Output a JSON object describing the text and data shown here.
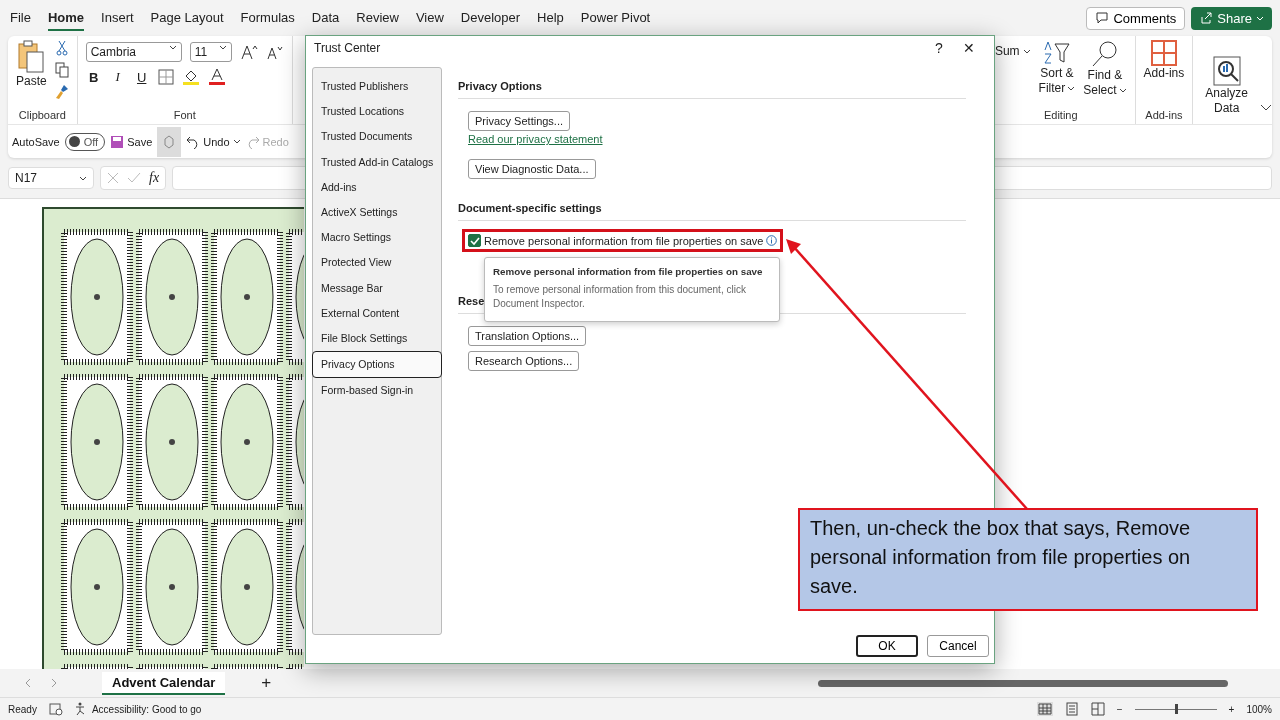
{
  "ribbon_tabs": [
    {
      "label": "File",
      "selected": false
    },
    {
      "label": "Home",
      "selected": true
    },
    {
      "label": "Insert",
      "selected": false
    },
    {
      "label": "Page Layout",
      "selected": false
    },
    {
      "label": "Formulas",
      "selected": false
    },
    {
      "label": "Data",
      "selected": false
    },
    {
      "label": "Review",
      "selected": false
    },
    {
      "label": "View",
      "selected": false
    },
    {
      "label": "Developer",
      "selected": false
    },
    {
      "label": "Help",
      "selected": false
    },
    {
      "label": "Power Pivot",
      "selected": false
    }
  ],
  "top_buttons": {
    "comments": "Comments",
    "share": "Share"
  },
  "ribbon": {
    "paste": "Paste",
    "clipboard_group": "Clipboard",
    "font_name": "Cambria",
    "font_size": "11",
    "font_group": "Font",
    "bold": "B",
    "italic": "I",
    "underline": "U",
    "sum": "Sum",
    "sort_filter": [
      "Sort &",
      "Filter"
    ],
    "find_select": [
      "Find &",
      "Select"
    ],
    "editing_group": "Editing",
    "addins": "Add-ins",
    "addins_group": "Add-ins",
    "analyze": [
      "Analyze",
      "Data"
    ]
  },
  "quick_access": {
    "autosave": "AutoSave",
    "toggle": {
      "label": "Off",
      "on": false
    },
    "save": "Save",
    "undo": "Undo",
    "redo": {
      "label": "Redo",
      "disabled": true
    }
  },
  "formula_bar": {
    "name_box": "N17",
    "fx": "fx"
  },
  "sheet_tabs": [
    {
      "label": "Advent Calendar",
      "selected": true
    }
  ],
  "add_sheet": "+",
  "status_bar": {
    "ready": "Ready",
    "accessibility": "Accessibility: Good to go",
    "zoom_minus": "−",
    "zoom_plus": "+",
    "zoom": "100%"
  },
  "zoom_slider": {
    "level": 0.5
  },
  "dialog": {
    "title": "Trust Center",
    "help": "?",
    "close": "✕",
    "nav": [
      {
        "label": "Trusted Publishers",
        "selected": false
      },
      {
        "label": "Trusted Locations",
        "selected": false
      },
      {
        "label": "Trusted Documents",
        "selected": false
      },
      {
        "label": "Trusted Add-in Catalogs",
        "selected": false
      },
      {
        "label": "Add-ins",
        "selected": false
      },
      {
        "label": "ActiveX Settings",
        "selected": false
      },
      {
        "label": "Macro Settings",
        "selected": false
      },
      {
        "label": "Protected View",
        "selected": false
      },
      {
        "label": "Message Bar",
        "selected": false
      },
      {
        "label": "External Content",
        "selected": false
      },
      {
        "label": "File Block Settings",
        "selected": false
      },
      {
        "label": "Privacy Options",
        "selected": true
      },
      {
        "label": "Form-based Sign-in",
        "selected": false
      }
    ],
    "privacy_heading": "Privacy Options",
    "privacy_settings": "Privacy Settings...",
    "privacy_link": "Read our privacy statement",
    "diagnostic": "View Diagnostic Data...",
    "document_heading": "Document-specific settings",
    "checkbox": {
      "label": "Remove personal information from file properties on save",
      "checked": true
    },
    "research_heading": "Rese",
    "translation": "Translation Options...",
    "research": "Research Options...",
    "tooltip": {
      "title": "Remove personal information from file properties on save",
      "body": "To remove personal information from this document, click Document Inspector."
    },
    "buttons": [
      "OK",
      "Cancel"
    ]
  },
  "callout": "Then, un-check the box that says, Remove personal information from file properties on save."
}
